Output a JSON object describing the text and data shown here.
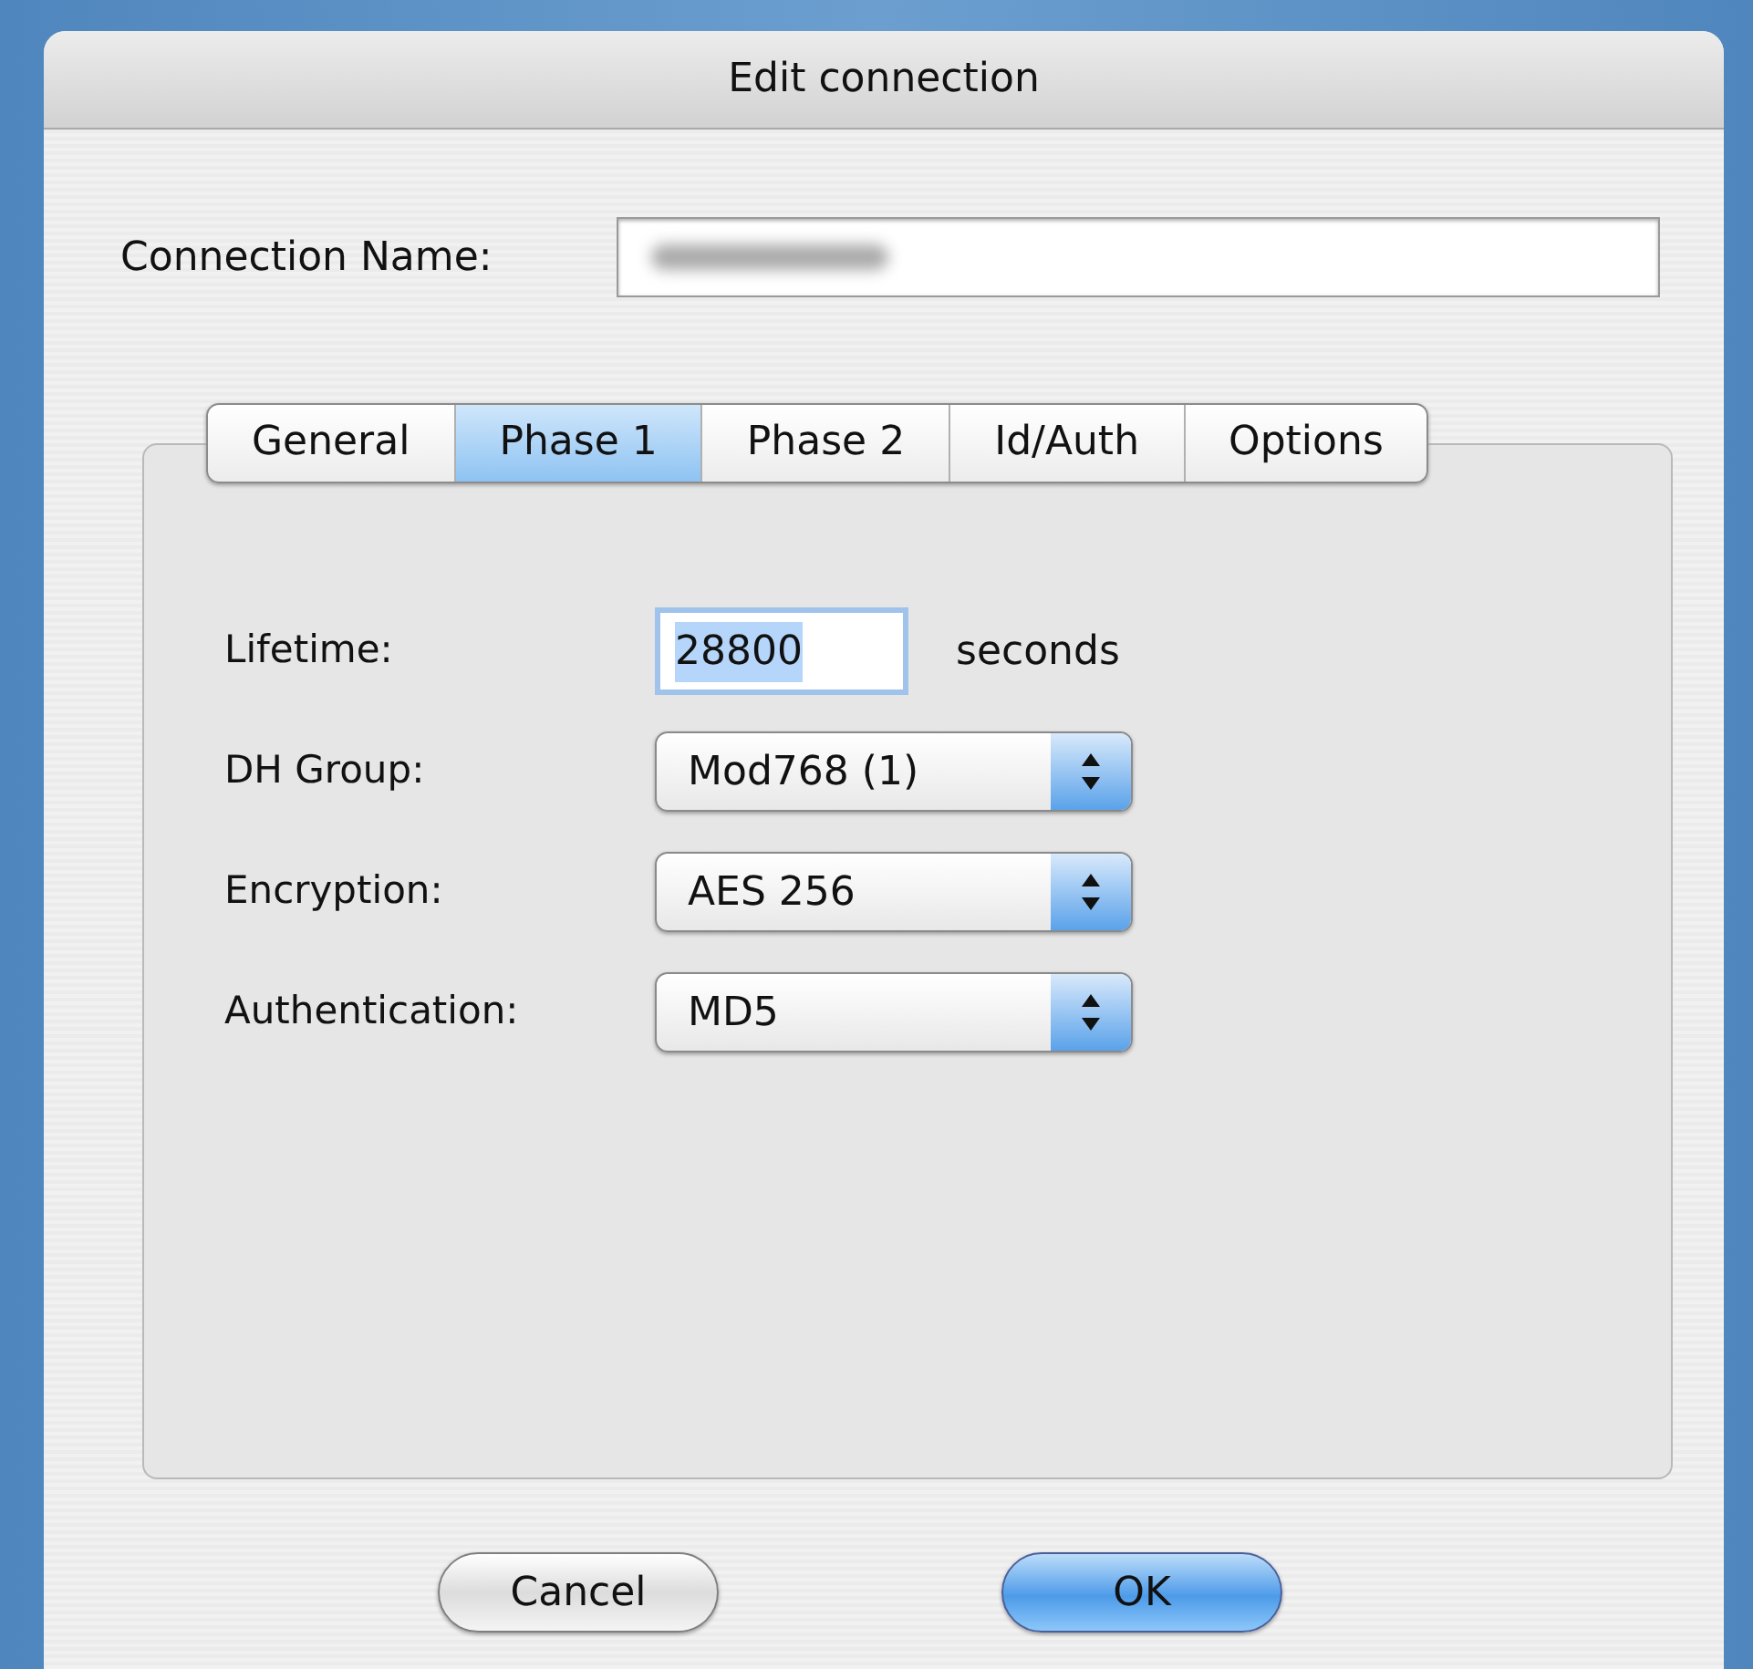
{
  "window": {
    "title": "Edit connection"
  },
  "connection_name": {
    "label": "Connection Name:"
  },
  "tabs": [
    {
      "label": "General",
      "selected": false
    },
    {
      "label": "Phase 1",
      "selected": true
    },
    {
      "label": "Phase 2",
      "selected": false
    },
    {
      "label": "Id/Auth",
      "selected": false
    },
    {
      "label": "Options",
      "selected": false
    }
  ],
  "fields": [
    {
      "kind": "text",
      "label": "Lifetime:",
      "value": "28800",
      "unit": "seconds",
      "value_selected": true
    },
    {
      "kind": "select",
      "label": "DH Group:",
      "value": "Mod768 (1)"
    },
    {
      "kind": "select",
      "label": "Encryption:",
      "value": "AES 256"
    },
    {
      "kind": "select",
      "label": "Authentication:",
      "value": "MD5"
    }
  ],
  "buttons": [
    {
      "label": "Cancel",
      "default": false
    },
    {
      "label": "OK",
      "default": true
    }
  ]
}
